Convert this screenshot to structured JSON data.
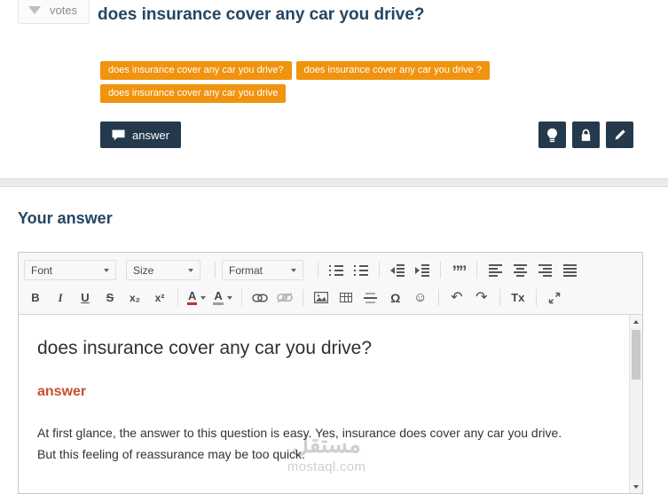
{
  "question": {
    "votes_label": "votes",
    "title": "does insurance cover any car you drive?",
    "tags": [
      "does insurance cover any car you drive?",
      "does insurance cover any car you drive ?",
      "does insurance cover any car you drive"
    ],
    "answer_button_label": "answer"
  },
  "your_answer": {
    "heading": "Your answer",
    "toolbar": {
      "font": "Font",
      "size": "Size",
      "format": "Format",
      "bold": "B",
      "italic": "I",
      "underline": "U",
      "strikethrough": "S",
      "subscript": "x₂",
      "superscript": "x²",
      "text_color": "A",
      "bg_color": "A",
      "remove_format": "Tx"
    },
    "content": {
      "title": "does insurance cover any car you drive?",
      "subheading": "answer",
      "paragraph": "At first glance, the answer to this question is easy. Yes, insurance does cover any car you drive. But this feeling of reassurance may be too quick."
    },
    "watermark": {
      "brand_ar": "مستقل",
      "domain": "mostaql.com"
    }
  },
  "icons": {
    "blockquote": "””",
    "omega": "Ω",
    "smiley": "☺",
    "undo": "↶",
    "redo": "↷"
  },
  "colors": {
    "accent_orange": "#f0930e",
    "navy": "#24394c",
    "heading_blue": "#254662",
    "subheading_red": "#c9502c"
  }
}
